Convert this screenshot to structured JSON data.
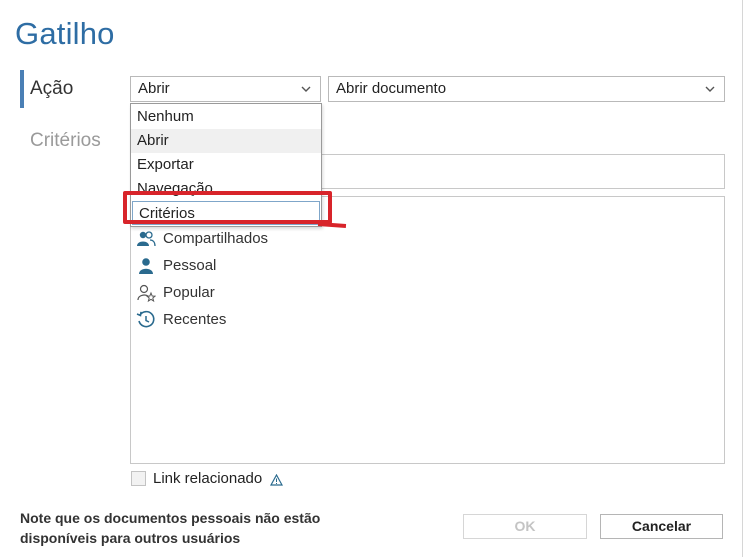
{
  "dialog": {
    "title": "Gatilho"
  },
  "nav": {
    "items": [
      {
        "label": "Ação"
      },
      {
        "label": "Critérios"
      }
    ]
  },
  "action": {
    "selected": "Abrir",
    "target_selected": "Abrir documento"
  },
  "dropdown": {
    "options": [
      "Nenhum",
      "Abrir",
      "Exportar",
      "Navegação",
      "Critérios"
    ]
  },
  "list": {
    "items": [
      {
        "label": "Compartilhados",
        "icon": "shared-users-icon"
      },
      {
        "label": "Pessoal",
        "icon": "person-icon"
      },
      {
        "label": "Popular",
        "icon": "popular-star-icon"
      },
      {
        "label": "Recentes",
        "icon": "history-icon"
      }
    ]
  },
  "link": {
    "label": "Link relacionado"
  },
  "footer": {
    "note_line1": "Note que os documentos pessoais não estão",
    "note_line2": "disponíveis para outros usuários",
    "ok_label": "OK",
    "cancel_label": "Cancelar"
  },
  "colors": {
    "title": "#2e6da4",
    "accent_bar": "#4a7fb5",
    "annotation": "#d8242a",
    "icon": "#2a6a8e"
  }
}
